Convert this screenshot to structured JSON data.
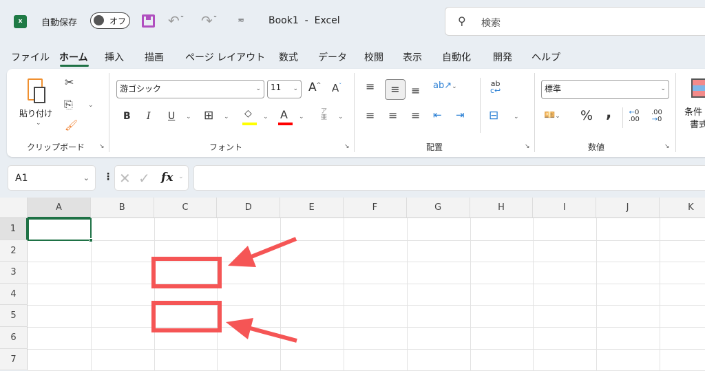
{
  "title_bar": {
    "autosave_label": "自動保存",
    "autosave_state": "オフ",
    "title": "Book1  -  Excel",
    "search_placeholder": "検索"
  },
  "tabs": [
    {
      "label": "ファイル"
    },
    {
      "label": "ホーム",
      "active": true
    },
    {
      "label": "挿入"
    },
    {
      "label": "描画"
    },
    {
      "label": "ページ レイアウト"
    },
    {
      "label": "数式"
    },
    {
      "label": "データ"
    },
    {
      "label": "校閲"
    },
    {
      "label": "表示"
    },
    {
      "label": "自動化"
    },
    {
      "label": "開発"
    },
    {
      "label": "ヘルプ"
    }
  ],
  "ribbon": {
    "clipboard": {
      "label": "クリップボード",
      "paste": "貼り付け"
    },
    "font": {
      "label": "フォント",
      "font_name": "游ゴシック",
      "font_size": "11",
      "bold": "B",
      "italic": "I",
      "underline": "U",
      "fill_color": "#ffff00",
      "font_color": "#ff0000"
    },
    "alignment": {
      "label": "配置"
    },
    "number": {
      "label": "数値",
      "format": "標準",
      "percent": "%",
      "comma": ","
    },
    "conditional": {
      "label_line1": "条件",
      "label_line2": "書式"
    }
  },
  "formula_bar": {
    "name_box": "A1",
    "fx": "fx",
    "value": ""
  },
  "sheet": {
    "columns": [
      "A",
      "B",
      "C",
      "D",
      "E",
      "F",
      "G",
      "H",
      "I",
      "J",
      "K"
    ],
    "rows": [
      "1",
      "2",
      "3",
      "4",
      "5",
      "6",
      "7"
    ],
    "active_cell": "A1"
  },
  "annotations": {
    "color": "#f55555"
  }
}
